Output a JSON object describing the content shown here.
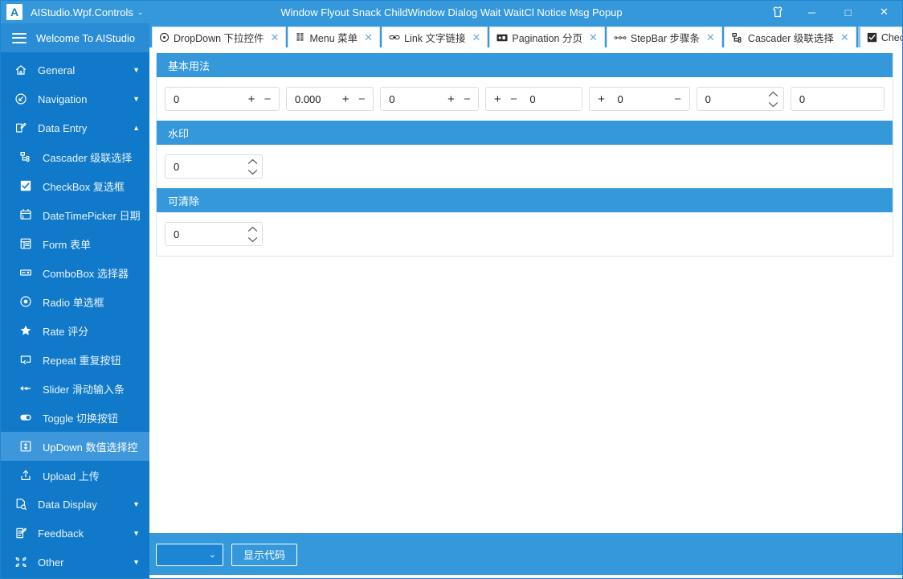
{
  "titlebar": {
    "logo": "A",
    "app_name": "AIStudio.Wpf.Controls",
    "app_chevron": "⌄",
    "center_text": "Window Flyout Snack ChildWindow Dialog Wait WaitCl Notice Msg Popup",
    "theme_icon": "shirt-icon",
    "minimize": "─",
    "maximize": "□",
    "close": "✕"
  },
  "sidebar": {
    "header": {
      "label": "Welcome To AIStudio",
      "icon": "hamburger-icon"
    },
    "items": [
      {
        "label": "General",
        "icon": "home-icon",
        "level": "group",
        "arrow": "▼",
        "active": false
      },
      {
        "label": "Navigation",
        "icon": "navigation-icon",
        "level": "group",
        "arrow": "▼",
        "active": false
      },
      {
        "label": "Data Entry",
        "icon": "edit-icon",
        "level": "group",
        "arrow": "▲",
        "active": false
      },
      {
        "label": "Cascader 级联选择",
        "icon": "cascader-icon",
        "level": "child",
        "arrow": "",
        "active": false
      },
      {
        "label": "CheckBox 复选框",
        "icon": "checkbox-icon",
        "level": "child",
        "arrow": "",
        "active": false
      },
      {
        "label": "DateTimePicker 日期",
        "icon": "calendar-icon",
        "level": "child",
        "arrow": "",
        "active": false
      },
      {
        "label": "Form 表单",
        "icon": "form-icon",
        "level": "child",
        "arrow": "",
        "active": false
      },
      {
        "label": "ComboBox 选择器",
        "icon": "combobox-icon",
        "level": "child",
        "arrow": "",
        "active": false
      },
      {
        "label": "Radio 单选框",
        "icon": "radio-icon",
        "level": "child",
        "arrow": "",
        "active": false
      },
      {
        "label": "Rate 评分",
        "icon": "star-icon",
        "level": "child",
        "arrow": "",
        "active": false
      },
      {
        "label": "Repeat 重复按钮",
        "icon": "repeat-icon",
        "level": "child",
        "arrow": "",
        "active": false
      },
      {
        "label": "Slider 滑动输入条",
        "icon": "slider-icon",
        "level": "child",
        "arrow": "",
        "active": false
      },
      {
        "label": "Toggle 切换按钮",
        "icon": "toggle-icon",
        "level": "child",
        "arrow": "",
        "active": false
      },
      {
        "label": "UpDown 数值选择控",
        "icon": "updown-icon",
        "level": "child",
        "arrow": "",
        "active": true
      },
      {
        "label": "Upload 上传",
        "icon": "upload-icon",
        "level": "child",
        "arrow": "",
        "active": false
      },
      {
        "label": "Data Display",
        "icon": "datadisplay-icon",
        "level": "group",
        "arrow": "▼",
        "active": false
      },
      {
        "label": "Feedback",
        "icon": "feedback-icon",
        "level": "group",
        "arrow": "▼",
        "active": false
      },
      {
        "label": "Other",
        "icon": "other-icon",
        "level": "group",
        "arrow": "▼",
        "active": false
      }
    ]
  },
  "tabs": [
    {
      "label": "DropDown 下拉控件",
      "icon": "target-icon",
      "close": "✕",
      "overflow": false
    },
    {
      "label": "Menu 菜单",
      "icon": "menu-icon",
      "close": "✕",
      "overflow": false
    },
    {
      "label": "Link 文字链接",
      "icon": "link-icon",
      "close": "✕",
      "overflow": false
    },
    {
      "label": "Pagination 分页",
      "icon": "pagination-icon",
      "close": "✕",
      "overflow": false
    },
    {
      "label": "StepBar 步骤条",
      "icon": "stepbar-icon",
      "close": "✕",
      "overflow": false
    },
    {
      "label": "Cascader 级联选择",
      "icon": "cascader-icon",
      "close": "✕",
      "overflow": false
    },
    {
      "label": "CheckI",
      "icon": "checkbox-icon",
      "close": "",
      "overflow": true,
      "chevron": "⌄"
    }
  ],
  "sections": [
    {
      "title": "基本用法",
      "controls": [
        {
          "name": "spinner-plain-right",
          "value": "0",
          "layout": "plus-minus-right",
          "width": 144
        },
        {
          "name": "spinner-decimal-right",
          "value": "0.000",
          "layout": "plus-minus-right",
          "width": 110
        },
        {
          "name": "spinner-wide-right",
          "value": "0",
          "layout": "plus-minus-right",
          "width": 124
        },
        {
          "name": "spinner-plus-minus-left",
          "value": "0",
          "layout": "plus-minus-left",
          "width": 122
        },
        {
          "name": "spinner-split",
          "value": "0",
          "layout": "split",
          "width": 126
        },
        {
          "name": "spinner-chevrons",
          "value": "0",
          "layout": "chevrons-right",
          "width": 110
        },
        {
          "name": "spinner-no-buttons",
          "value": "0",
          "layout": "none",
          "width": 118
        }
      ]
    },
    {
      "title": "水印",
      "controls": [
        {
          "name": "spinner-watermark",
          "value": "0",
          "layout": "chevrons-right",
          "width": 122
        }
      ]
    },
    {
      "title": "可清除",
      "controls": [
        {
          "name": "spinner-clearable",
          "value": "0",
          "layout": "chevrons-right",
          "width": 122
        }
      ]
    }
  ],
  "bottombar": {
    "combo_value": "",
    "combo_chevron": "⌄",
    "show_code_label": "显示代码"
  },
  "colors": {
    "accent": "#3498db",
    "sidebar": "#1179c9",
    "sidebar_active": "#3d97da",
    "sidebar_header": "#2b8cd6"
  }
}
